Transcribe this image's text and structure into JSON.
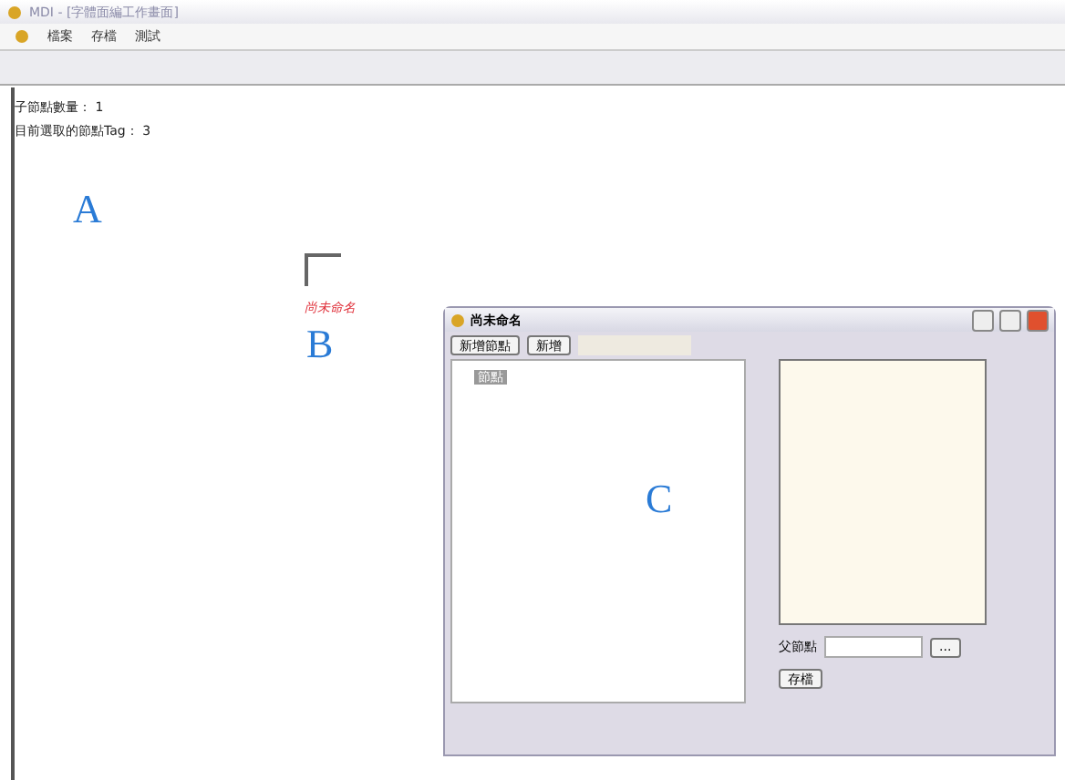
{
  "window": {
    "title": "MDI - [字體面編工作畫面]"
  },
  "menu": [
    "檔案",
    "存檔",
    "測試"
  ],
  "info": [
    {
      "label": "子節點數量：",
      "value": "1"
    },
    {
      "label": "目前選取的節點Tag：",
      "value": "3"
    }
  ],
  "annotations": [
    "A",
    "B",
    "C"
  ],
  "canvas_label": "尚未命名",
  "child_window": {
    "title": "尚未命名",
    "buttons": [
      "新增節點",
      "新增"
    ],
    "tree": [
      {
        "label": "節點",
        "selected": true
      }
    ],
    "parent_label": "父節點",
    "browse_button": "...",
    "save_button": "存檔"
  }
}
